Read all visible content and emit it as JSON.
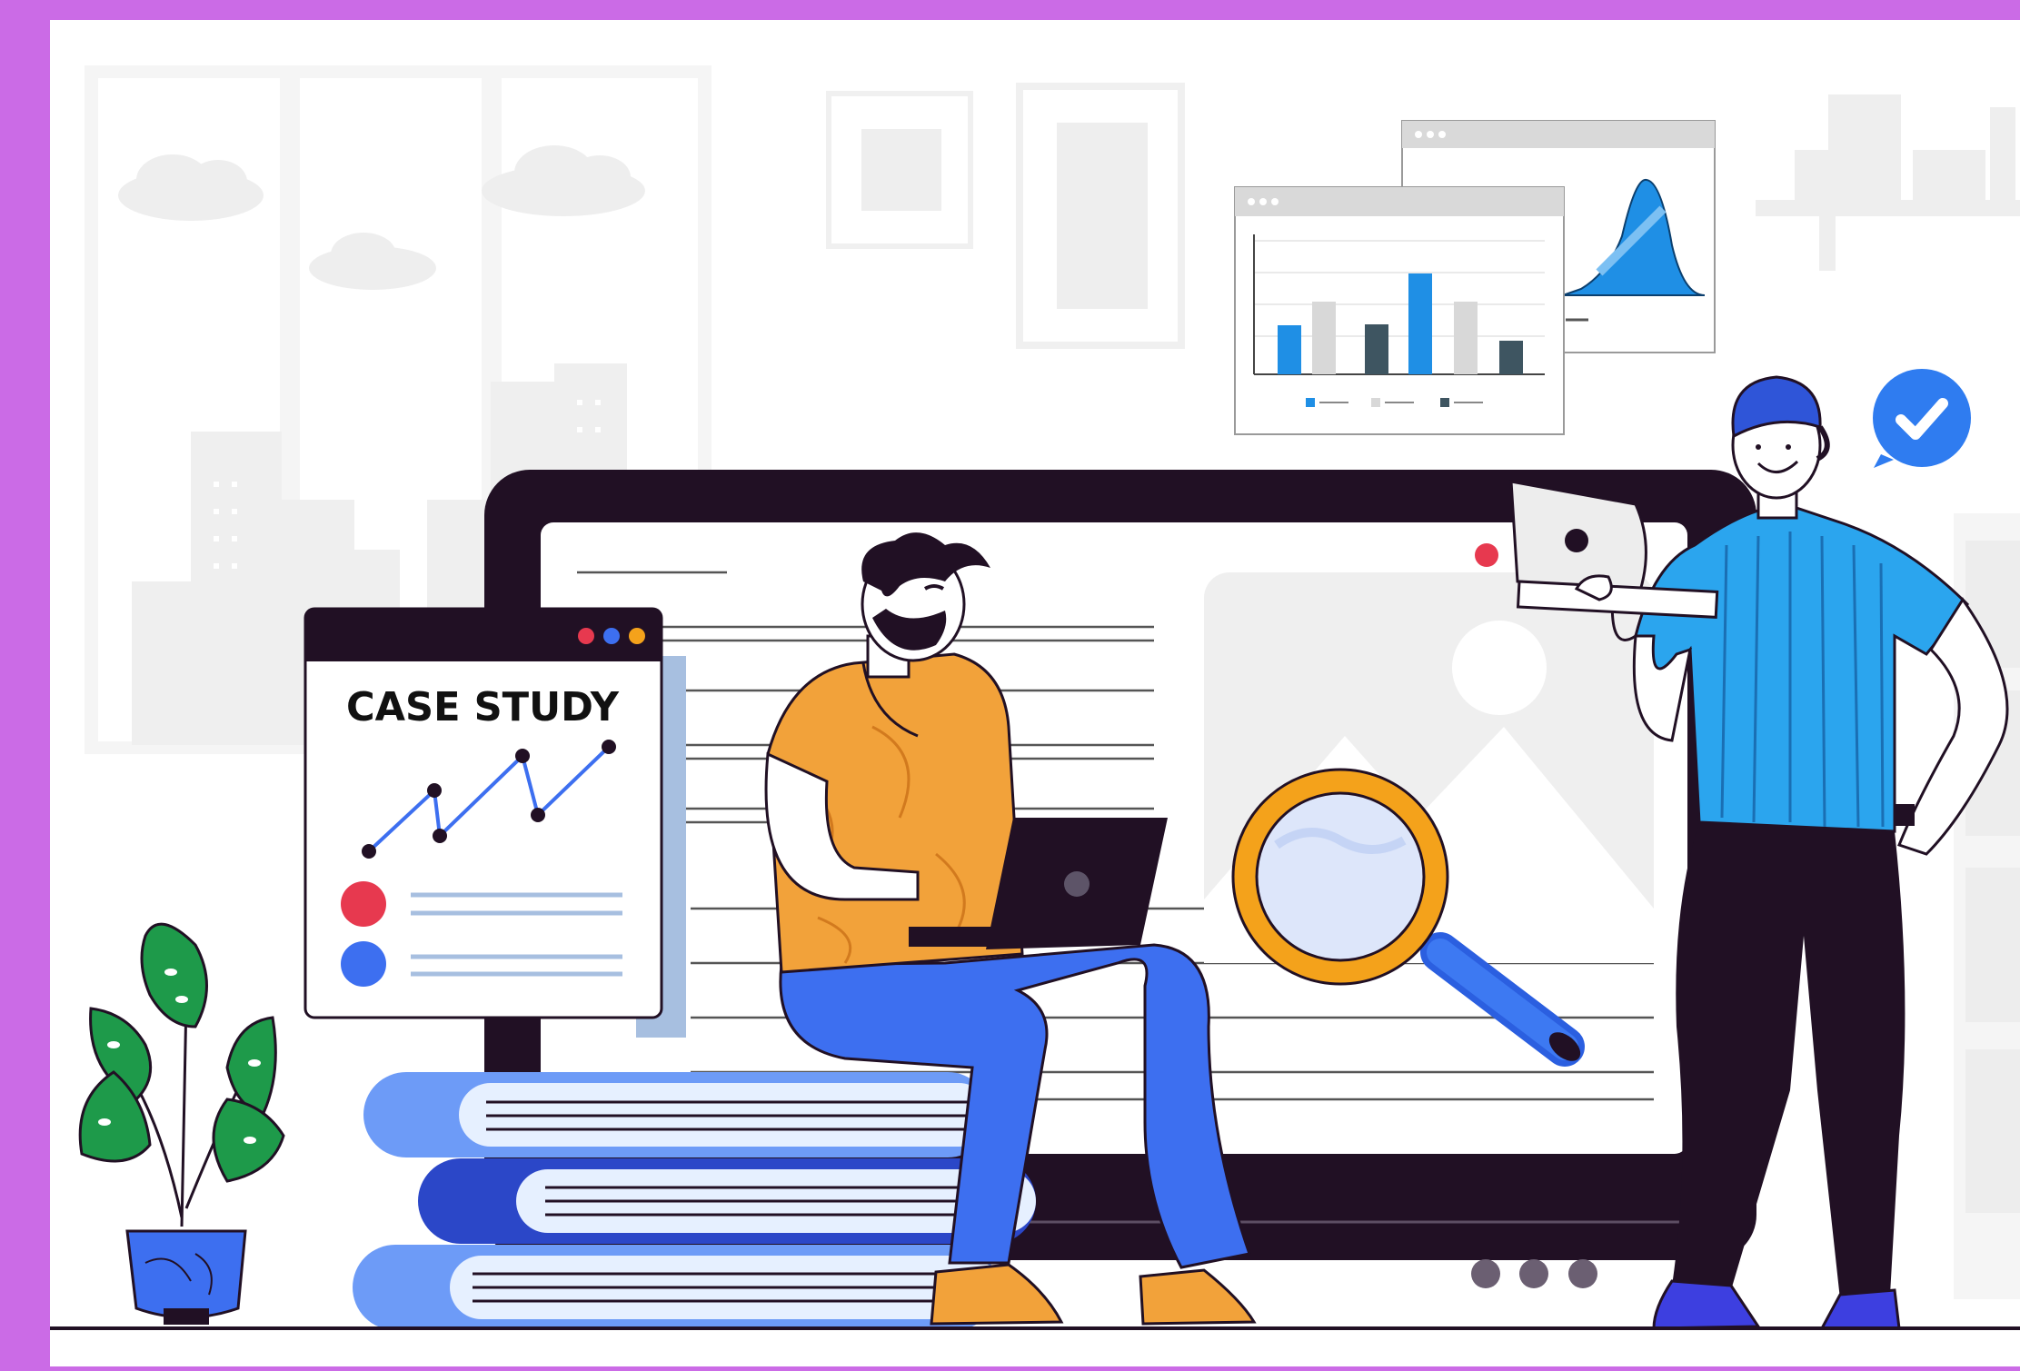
{
  "colors": {
    "frame": "#CB6BE6",
    "background": "#FFFFFF",
    "dark": "#211024",
    "blue": "#1F8FE5",
    "bright_blue": "#3D6FF0",
    "orange": "#F2A23A",
    "red": "#E7394F",
    "amber": "#F4A21B",
    "grey_bar": "#D8D8D8",
    "slate": "#3E5561",
    "green": "#1E9A4A"
  },
  "case_study_card": {
    "title": "CASE STUDY",
    "window_dots": [
      "#E7394F",
      "#3D6FF0",
      "#F4A21B"
    ]
  },
  "icons": {
    "check": "check-badge-icon",
    "magnifier": "magnifying-glass-icon",
    "plant": "potted-plant-icon"
  }
}
